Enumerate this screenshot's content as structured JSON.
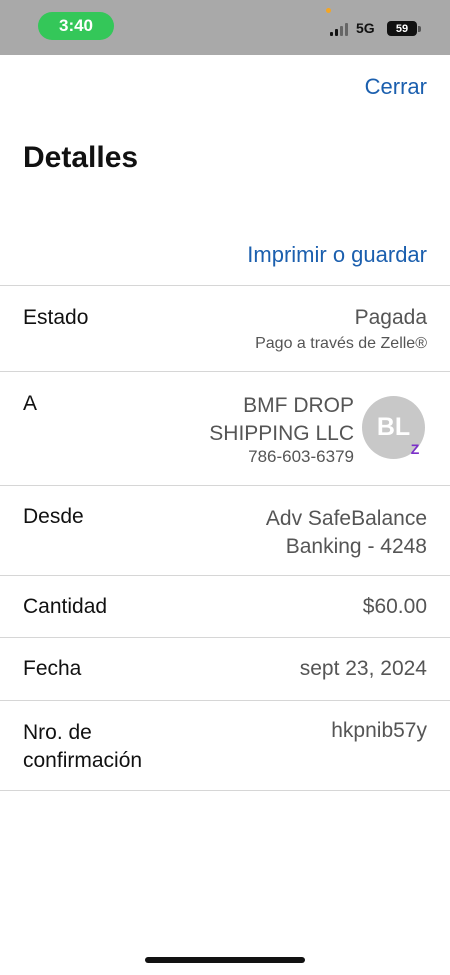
{
  "status_bar": {
    "time": "3:40",
    "network": "5G",
    "battery": "59"
  },
  "header": {
    "close_label": "Cerrar",
    "title": "Detalles",
    "print_label": "Imprimir o guardar"
  },
  "rows": {
    "estado": {
      "label": "Estado",
      "value": "Pagada",
      "sub": "Pago a través de Zelle®"
    },
    "a": {
      "label": "A",
      "value_line1": "BMF DROP",
      "value_line2": "SHIPPING LLC",
      "phone": "786-603-6379",
      "avatar_initials": "BL",
      "badge_icon": "zelle-icon"
    },
    "desde": {
      "label": "Desde",
      "value_line1": "Adv SafeBalance",
      "value_line2": "Banking - 4248"
    },
    "cantidad": {
      "label": "Cantidad",
      "value": "$60.00"
    },
    "fecha": {
      "label": "Fecha",
      "value": "sept 23, 2024"
    },
    "confirmacion": {
      "label_line1": "Nro. de",
      "label_line2": "confirmación",
      "value": "hkpnib57y"
    }
  },
  "colors": {
    "link": "#1b5fae",
    "status_bar": "#a9a9a9",
    "time_pill": "#34c759",
    "zelle": "#7b2fc9"
  }
}
